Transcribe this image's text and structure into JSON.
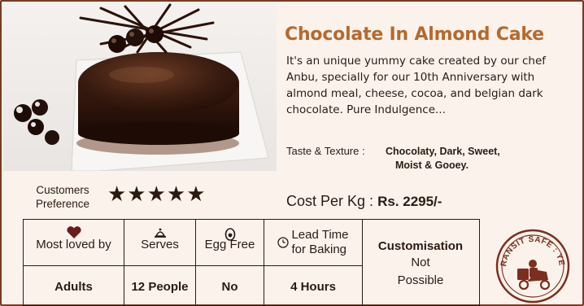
{
  "product": {
    "title": "Chocolate In Almond Cake",
    "description": "It's an unique yummy cake created by our chef Anbu, specially for our 10th Anniversary with almond meal, cheese, cocoa, and belgian dark chocolate. Pure Indulgence...",
    "taste_label": "Taste & Texture :",
    "taste_line1": "Chocolaty, Dark, Sweet,",
    "taste_line2": "Moist & Gooey."
  },
  "preference": {
    "label_line1": "Customers",
    "label_line2": "Preference",
    "stars": "★★★★★",
    "rating": 5
  },
  "cost": {
    "label": "Cost Per Kg :",
    "value": "Rs. 2295/-"
  },
  "info": {
    "columns": [
      {
        "icon": "heart-icon",
        "label": "Most loved by",
        "value": "Adults"
      },
      {
        "icon": "serves-icon",
        "label": "Serves",
        "value": "12 People"
      },
      {
        "icon": "egg-icon",
        "label": "Egg Free",
        "value": "No"
      },
      {
        "icon": "clock-icon",
        "label_line1": "Lead Time",
        "label_line2": "for Baking",
        "value": "4 Hours"
      }
    ],
    "customisation": {
      "title": "Customisation",
      "line1": "Not",
      "line2": "Possible"
    }
  },
  "badge": {
    "text": "TRANSIT SAFE : YES",
    "icon": "delivery-scooter-icon"
  },
  "colors": {
    "title": "#b5692f",
    "border": "#7a3a24",
    "background": "#fbf3eb"
  }
}
